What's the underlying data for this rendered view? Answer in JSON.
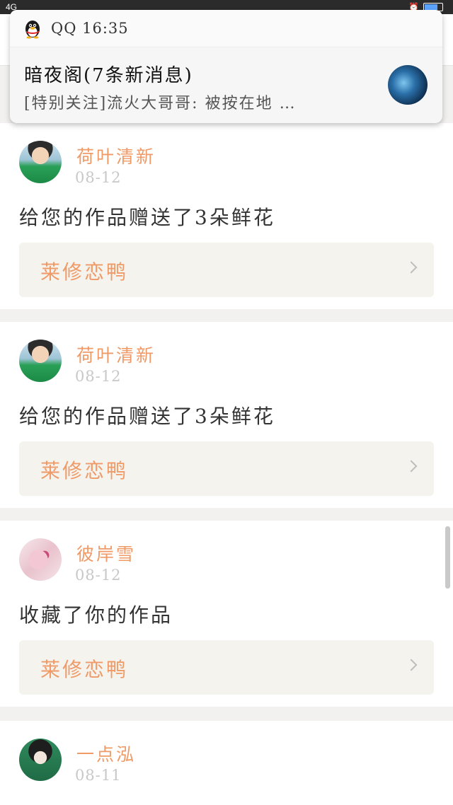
{
  "status_bar": {
    "left_text": "4G",
    "battery_level_percent": 74
  },
  "notification": {
    "app_name": "QQ",
    "time": "16:35",
    "title": "暗夜阁(7条新消息)",
    "body": "[特别关注]流火大哥哥: 被按在地 …"
  },
  "feed": {
    "items": [
      {
        "username": "荷叶清新",
        "date": "08-12",
        "message": "给您的作品赠送了3朵鲜花",
        "work_title": "莱修恋鸭"
      },
      {
        "username": "荷叶清新",
        "date": "08-12",
        "message": "给您的作品赠送了3朵鲜花",
        "work_title": "莱修恋鸭"
      },
      {
        "username": "彼岸雪",
        "date": "08-12",
        "message": "收藏了你的作品",
        "work_title": "莱修恋鸭"
      },
      {
        "username": "一点泓",
        "date": "08-11",
        "message": "",
        "work_title": ""
      }
    ]
  },
  "colors": {
    "accent": "#ef9a67",
    "date_gray": "#c8c8c8",
    "text": "#333333",
    "box_bg": "#f4f3ee",
    "page_bg": "#f2f1ef"
  }
}
